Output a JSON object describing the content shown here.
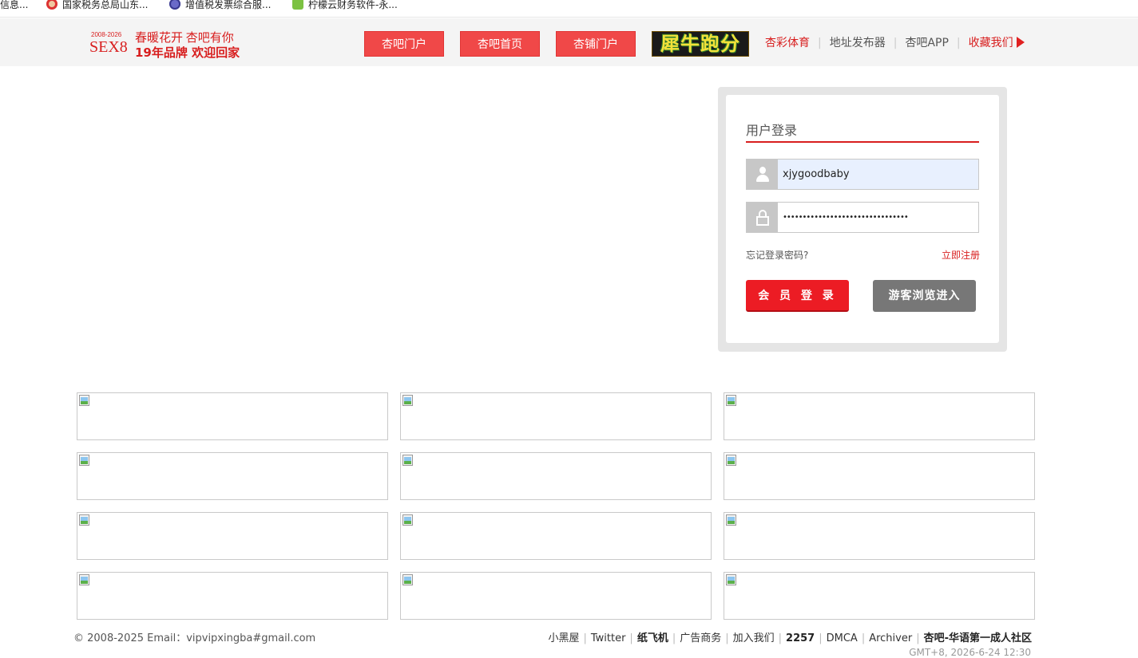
{
  "bookmarks": [
    {
      "label": "信息..."
    },
    {
      "label": "国家税务总局山东...",
      "icon": "tax-bureau-icon"
    },
    {
      "label": "增值税发票综合服...",
      "icon": "globe-icon"
    },
    {
      "label": "柠檬云财务软件-永...",
      "icon": "lemon-cloud-icon"
    }
  ],
  "header": {
    "logo": {
      "years": "2008-2026",
      "brand": "SEX8",
      "line1": "春暖花开 杏吧有你",
      "line2": "19年品牌 欢迎回家"
    },
    "nav_buttons": [
      "杏吧门户",
      "杏吧首页",
      "杏铺门户"
    ],
    "banner_text": "犀牛跑分",
    "links": [
      "杏彩体育",
      "地址发布器",
      "杏吧APP",
      "收藏我们"
    ]
  },
  "login": {
    "title": "用户登录",
    "username_value": "xjygoodbaby",
    "password_masked": "••••••••••••••••••••••••••••••••",
    "forgot_label": "忘记登录密码?",
    "register_label": "立即注册",
    "login_button": "会 员 登 录",
    "guest_button": "游客浏览进入"
  },
  "ads": {
    "count": 12,
    "icon": "broken-image-icon"
  },
  "footer": {
    "copyright": "© 2008-2025 Email：vipvipxingba#gmail.com",
    "links": [
      {
        "label": "小黑屋",
        "bold": false
      },
      {
        "label": "Twitter",
        "bold": false
      },
      {
        "label": "纸飞机",
        "bold": true
      },
      {
        "label": "广告商务",
        "bold": false
      },
      {
        "label": "加入我们",
        "bold": false
      },
      {
        "label": "2257",
        "bold": true
      },
      {
        "label": "DMCA",
        "bold": false
      },
      {
        "label": "Archiver",
        "bold": false
      },
      {
        "label": "杏吧-华语第一成人社区",
        "bold": true
      }
    ],
    "time": "GMT+8, 2026-6-24 12:30"
  },
  "colors": {
    "accent_red": "#d81e1e",
    "nav_button": "#f04848",
    "login_button": "#ec1c24",
    "guest_button": "#777777",
    "header_bg": "#f4f4f4"
  }
}
